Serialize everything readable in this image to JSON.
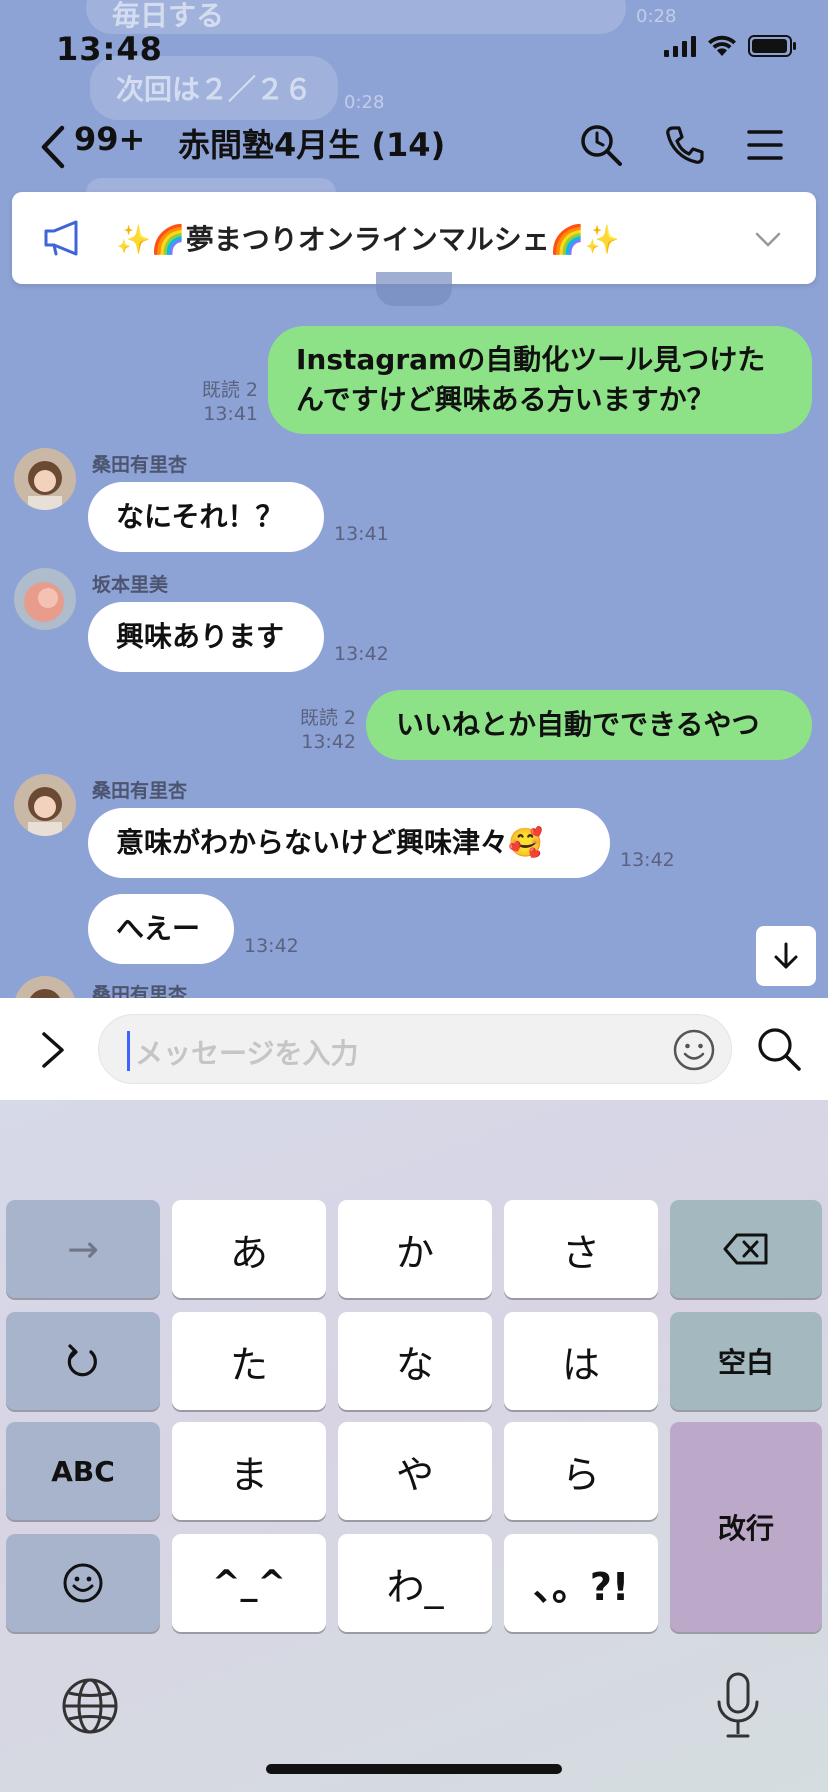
{
  "status": {
    "time": "13:48"
  },
  "ghost": {
    "msg1": "毎日する",
    "msg1_time": "0:28",
    "msg2": "次回は２／２６",
    "msg2_time": "0:28"
  },
  "header": {
    "back_count": "99+",
    "title": "赤間塾4月生 (14)"
  },
  "announcement": {
    "text": "✨🌈夢まつりオンラインマルシェ🌈✨"
  },
  "messages": [
    {
      "direction": "out",
      "text_line1": "Instagramの自動化ツール見つけた",
      "text_line2": "んですけど興味ある方いますか？",
      "read": "既読 2",
      "time": "13:41"
    },
    {
      "direction": "in",
      "sender": "桑田有里杏",
      "text": "なにそれ！？",
      "time": "13:41"
    },
    {
      "direction": "in",
      "sender": "坂本里美",
      "text": "興味あります",
      "time": "13:42"
    },
    {
      "direction": "out",
      "text": "いいねとか自動でできるやつ",
      "read": "既読 2",
      "time": "13:42"
    },
    {
      "direction": "in",
      "sender": "桑田有里杏",
      "text": "意味がわからないけど興味津々🥰",
      "time": "13:42"
    },
    {
      "direction": "in",
      "sender": "",
      "text": "へえー",
      "time": "13:42"
    },
    {
      "direction": "in",
      "sender": "桑田有里杏",
      "text": "",
      "time": ""
    }
  ],
  "input": {
    "placeholder": "メッセージを入力"
  },
  "keyboard": {
    "row1": [
      "→",
      "あ",
      "か",
      "さ",
      "delete"
    ],
    "row2": [
      "undo",
      "た",
      "な",
      "は",
      "空白"
    ],
    "row3": [
      "ABC",
      "ま",
      "や",
      "ら"
    ],
    "row4": [
      "emoji",
      "^_^",
      "わ_",
      "、。?!"
    ],
    "enter": "改行"
  }
}
